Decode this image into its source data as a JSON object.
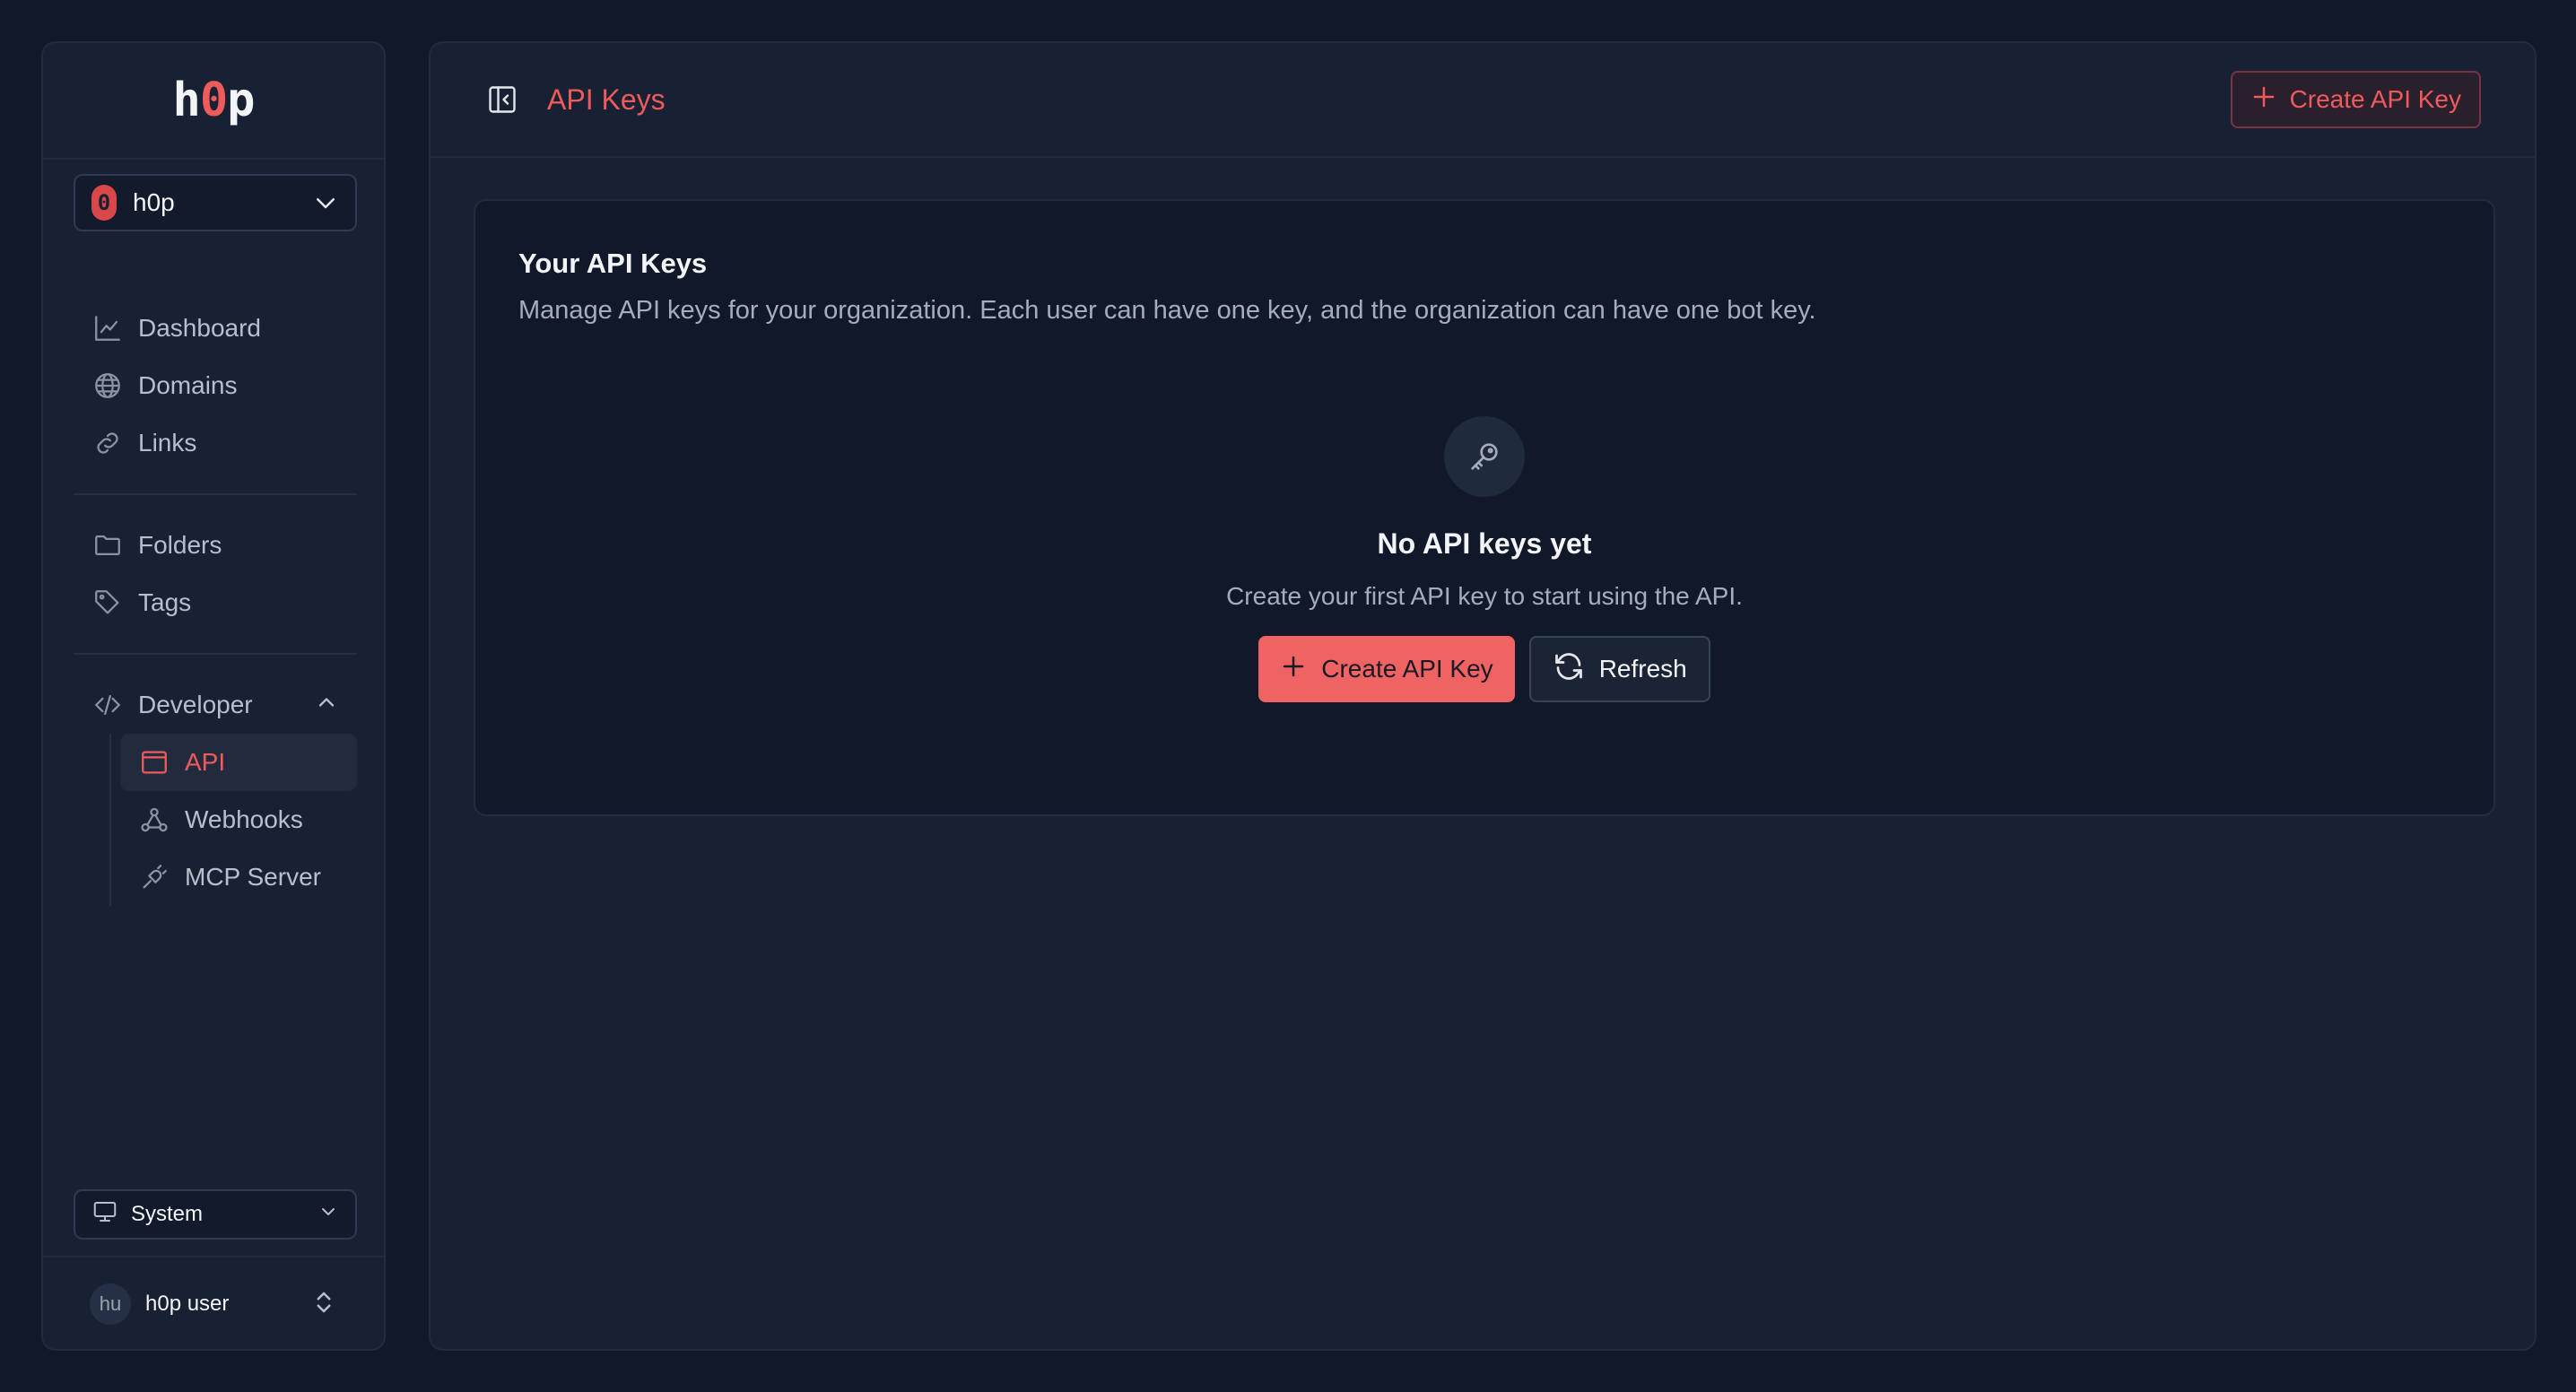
{
  "brand": {
    "logo_left": "h",
    "logo_accent": "0",
    "logo_right": "p"
  },
  "org": {
    "icon_glyph": "0",
    "name": "h0p"
  },
  "nav": {
    "dashboard": "Dashboard",
    "domains": "Domains",
    "links": "Links",
    "folders": "Folders",
    "tags": "Tags",
    "developer": "Developer",
    "api": "API",
    "webhooks": "Webhooks",
    "mcp_server": "MCP Server"
  },
  "theme": {
    "value": "System"
  },
  "user": {
    "initials": "hu",
    "name": "h0p user"
  },
  "header": {
    "title": "API Keys",
    "create_label": "Create API Key"
  },
  "card": {
    "title": "Your API Keys",
    "description": "Manage API keys for your organization. Each user can have one key, and the organization can have one bot key."
  },
  "empty_state": {
    "title": "No API keys yet",
    "subtitle": "Create your first API key to start using the API.",
    "create_label": "Create API Key",
    "refresh_label": "Refresh"
  },
  "colors": {
    "accent": "#ef5b5b",
    "background": "#111829",
    "panel": "#182133"
  }
}
